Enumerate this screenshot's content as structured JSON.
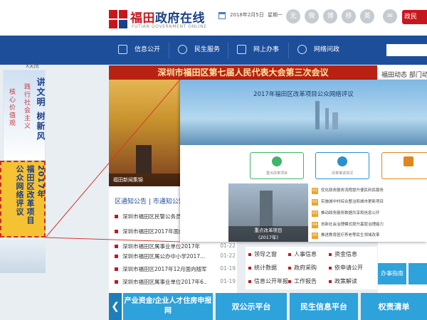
{
  "header": {
    "site_title_red": "福田",
    "site_title_blue": "政府在线",
    "site_subtitle": "FUTIAN GOVERNMENT ONLINE",
    "date": "2018年2月5日",
    "weekday": "星期一",
    "icon_labels": [
      "无",
      "微",
      "博",
      "移",
      "英"
    ],
    "red_tag": "政民"
  },
  "nav": {
    "items": [
      "信息公开",
      "民生服务",
      "网上办事",
      "网络问政"
    ]
  },
  "left_banner": {
    "close_label": "X关闭",
    "slogan_main": "讲文明 树新风",
    "slogan_line1": "践行社会主义",
    "slogan_line2": "核心价值观",
    "reform_text": "2017年\n福田区改革项目\n公众网络评议"
  },
  "main_photo": {
    "banner": "深圳市福田区第七届人民代表大会第三次会议",
    "caption": "福田新闻集锦"
  },
  "notices": {
    "tabs": "区通知公告 | 市通知公告",
    "rows": [
      {
        "title": "深圳市福田区民警公务员",
        "date": ""
      },
      {
        "title": "深圳市福田区2017年面向",
        "date": ""
      },
      {
        "title": "深圳市福田区属事业单位2017年",
        "date": "01-22"
      },
      {
        "title": "深圳市福田区属公办中小学2017...",
        "date": "01-22"
      },
      {
        "title": "深圳市福田区2017年12月面向随军...",
        "date": "01-19"
      },
      {
        "title": "深圳市福田区属事业单位2017年6...",
        "date": "01-19"
      }
    ]
  },
  "links": {
    "items": [
      "领导之窗",
      "人事信息",
      "资金信息",
      "统计数据",
      "政府采购",
      "依申请公开",
      "信息公开年报",
      "工作报告",
      "政策解读"
    ]
  },
  "right_col": {
    "tabs": "福田动态  部门动态",
    "guide_button": "办事指南"
  },
  "overlay": {
    "title": "2017年福田区改革项目公众网络评议",
    "description": "",
    "photo_caption_line1": "重点改革项目",
    "photo_caption_line2": "(2017年)",
    "features": [
      {
        "label": "重点改革项目",
        "color": "#3fb56a"
      },
      {
        "label": "改革推进情况",
        "color": "#2c8fcf"
      },
      {
        "label": "",
        "color": "#e0861e"
      }
    ],
    "rows": [
      {
        "num": "01",
        "title": "优化政务服务流程提升便民利民服务",
        "date": ""
      },
      {
        "num": "02",
        "title": "实施城中村综合整治和城市更新项目",
        "date": ""
      },
      {
        "num": "03",
        "title": "推动政务服务数据共享和信息公开",
        "date": ""
      },
      {
        "num": "04",
        "title": "创新社会治理模式提升基层治理能力",
        "date": ""
      },
      {
        "num": "05",
        "title": "推进教育医疗养老等民生领域改革",
        "date": ""
      }
    ]
  },
  "bottom_bar": {
    "arrow": "❮",
    "buttons": [
      "产业资金/企业人才住房申报网",
      "双公示平台",
      "民生信息平台",
      "权责清单"
    ]
  },
  "colors": {
    "brand_red": "#c8161d",
    "nav_blue": "#1d4e9a",
    "service_blue": "#2ea2da",
    "banner_yellow": "#f5c233"
  }
}
